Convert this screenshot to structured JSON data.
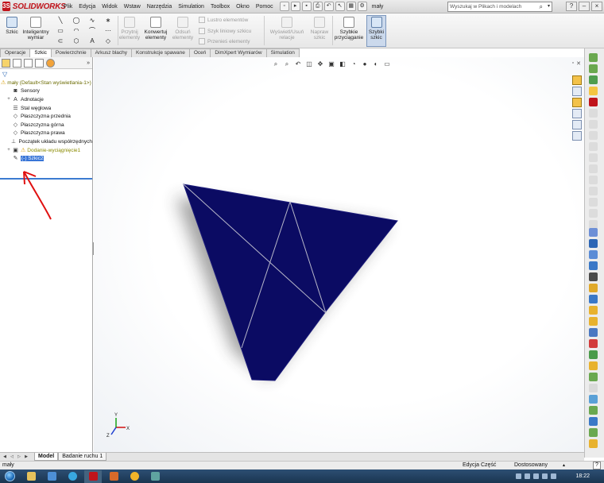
{
  "app": {
    "logo_text": "SOLIDWORKS",
    "document_name": "mały"
  },
  "menu": [
    "Plik",
    "Edycja",
    "Widok",
    "Wstaw",
    "Narzędzia",
    "Simulation",
    "Toolbox",
    "Okno",
    "Pomoc"
  ],
  "search": {
    "placeholder": "Wyszukaj w Plikach i modelach"
  },
  "ribbon": {
    "sketch": "Szkic",
    "smart_dim_1": "Inteligentny",
    "smart_dim_2": "wymiar",
    "trim_1": "Przytnij",
    "trim_2": "elementy",
    "convert_1": "Konwertuj",
    "convert_2": "elementy",
    "offset_1": "Odsuń",
    "offset_2": "elementy",
    "mirror": "Lustro elementów",
    "linear_pattern": "Szyk liniowy szkicu",
    "move": "Przenieś elementy",
    "relations_1": "Wyświetl/Usuń",
    "relations_2": "relacje",
    "repair_1": "Napraw",
    "repair_2": "szkic",
    "quick_snaps_1": "Szybkie",
    "quick_snaps_2": "przyciąganie",
    "rapid_sketch_1": "Szybki",
    "rapid_sketch_2": "szkic"
  },
  "tabs": [
    {
      "label": "Operacje",
      "active": false
    },
    {
      "label": "Szkic",
      "active": true
    },
    {
      "label": "Powierzchnie",
      "active": false
    },
    {
      "label": "Arkusz blachy",
      "active": false
    },
    {
      "label": "Konstrukcje spawane",
      "active": false
    },
    {
      "label": "Oceń",
      "active": false
    },
    {
      "label": "DimXpert Wymiarów",
      "active": false
    },
    {
      "label": "Simulation",
      "active": false
    }
  ],
  "tree": {
    "root": "mały (Default<Stan wyświetlania-1>)",
    "items": [
      {
        "label": "Sensory",
        "expand": ""
      },
      {
        "label": "Adnotacje",
        "expand": "+"
      },
      {
        "label": "Stal węglowa",
        "expand": ""
      },
      {
        "label": "Płaszczyzna przednia",
        "expand": ""
      },
      {
        "label": "Płaszczyzna górna",
        "expand": ""
      },
      {
        "label": "Płaszczyzna prawa",
        "expand": ""
      },
      {
        "label": "Początek układu współrzędnych",
        "expand": ""
      },
      {
        "label": "Dodanie-wyciągnięcie1",
        "expand": "+"
      }
    ],
    "selected": "(-) Szkic2"
  },
  "model_tabs": [
    {
      "label": "Model",
      "active": true
    },
    {
      "label": "Badanie ruchu 1",
      "active": false
    }
  ],
  "status": {
    "left": "mały",
    "mode": "Edycja Część",
    "units": "Dostosowany",
    "help": "?"
  },
  "taskbar": {
    "clock": "18:22"
  },
  "triad": {
    "x": "X",
    "y": "Y",
    "z": "Z"
  },
  "colors": {
    "part_fill": "#0b0b63",
    "accent": "#3875d7",
    "arrow": "#e01010"
  }
}
